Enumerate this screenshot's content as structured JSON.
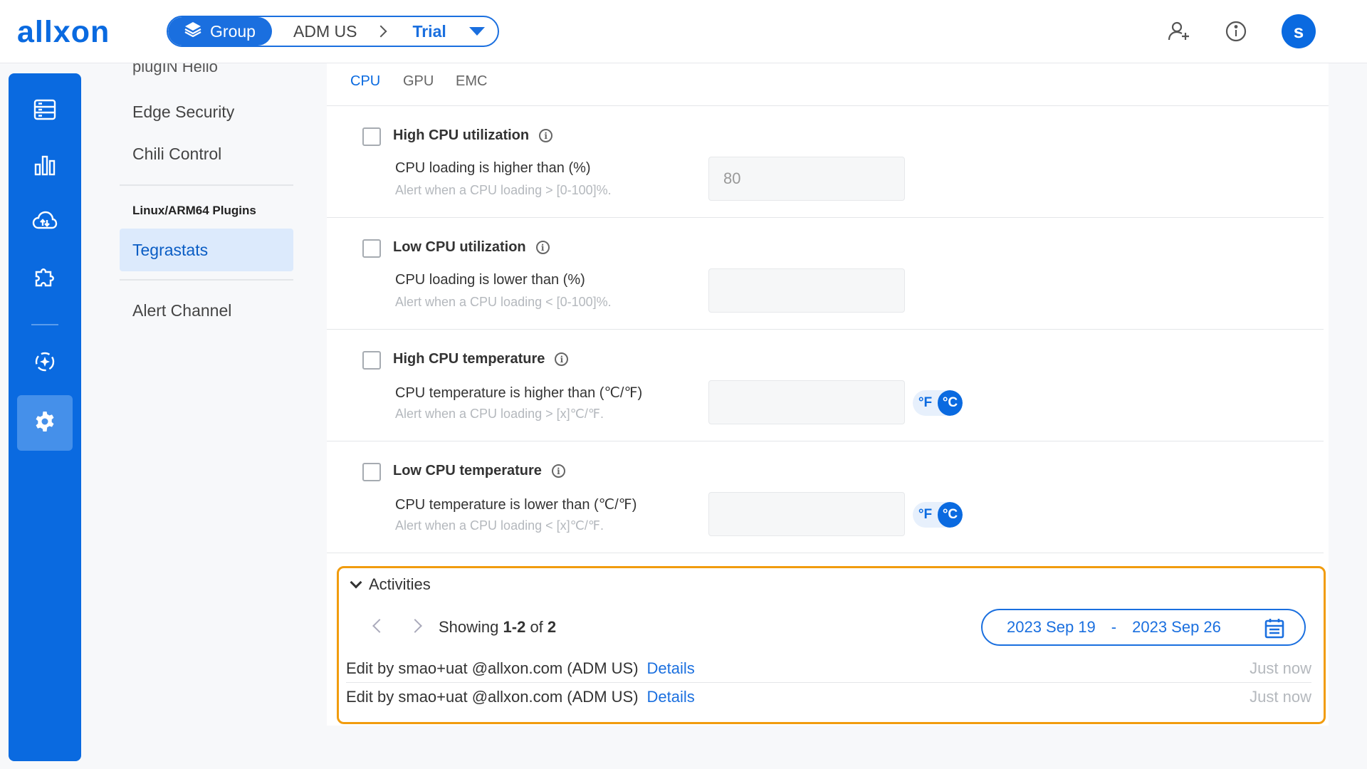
{
  "header": {
    "logo": "allxon",
    "breadcrumb": {
      "group_label": "Group",
      "org": "ADM US",
      "current": "Trial"
    },
    "avatar_initial": "s"
  },
  "rail": {
    "items": [
      {
        "icon": "devices-icon"
      },
      {
        "icon": "chart-icon"
      },
      {
        "icon": "cloud-icon"
      },
      {
        "icon": "plugin-icon"
      },
      {
        "icon": "ota-icon"
      },
      {
        "icon": "settings-icon",
        "active": true
      }
    ]
  },
  "menu": {
    "cut_item": "plugIN Hello",
    "items": [
      "Edge Security",
      "Chili Control"
    ],
    "section": "Linux/ARM64 Plugins",
    "active_item": "Tegrastats",
    "bottom_item": "Alert Channel"
  },
  "tabs": [
    "CPU",
    "GPU",
    "EMC"
  ],
  "rules": [
    {
      "title": "High CPU utilization",
      "label": "CPU loading is higher than (%)",
      "hint": "Alert when a CPU loading > [0-100]%.",
      "value": "80",
      "has_unit": false
    },
    {
      "title": "Low CPU utilization",
      "label": "CPU loading is lower than (%)",
      "hint": "Alert when a CPU loading < [0-100]%.",
      "value": "",
      "has_unit": false
    },
    {
      "title": "High CPU temperature",
      "label": "CPU temperature is higher than (℃/℉)",
      "hint": "Alert when a CPU loading > [x]℃/℉.",
      "value": "",
      "has_unit": true
    },
    {
      "title": "Low CPU temperature",
      "label": "CPU temperature is lower than (℃/℉)",
      "hint": "Alert when a CPU loading < [x]℃/℉.",
      "value": "",
      "has_unit": true
    }
  ],
  "units": {
    "f": "°F",
    "c": "°C"
  },
  "activities": {
    "title": "Activities",
    "showing_prefix": "Showing",
    "range": "1-2",
    "of": "of",
    "total": "2",
    "date_from": "2023 Sep 19",
    "date_sep": "-",
    "date_to": "2023 Sep 26",
    "rows": [
      {
        "text": "Edit by smao+uat @allxon.com (ADM US)",
        "link": "Details",
        "when": "Just now"
      },
      {
        "text": "Edit by smao+uat @allxon.com (ADM US)",
        "link": "Details",
        "when": "Just now"
      }
    ]
  }
}
